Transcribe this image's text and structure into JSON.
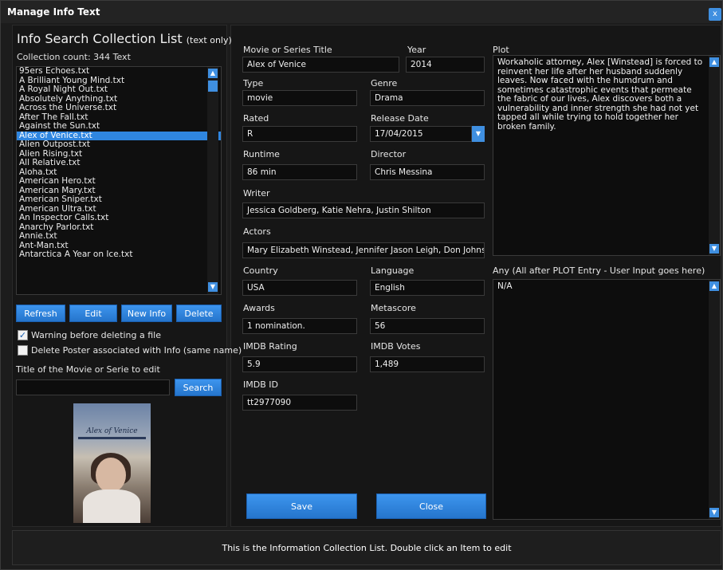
{
  "window": {
    "title": "Manage Info Text",
    "close_glyph": "x"
  },
  "list": {
    "title": "Info Search Collection List",
    "title_suffix": "(text only)",
    "count_text": "Collection count: 344 Text",
    "items": [
      "95ers Echoes.txt",
      "A Brilliant Young Mind.txt",
      "A Royal Night Out.txt",
      "Absolutely Anything.txt",
      "Across the Universe.txt",
      "After The Fall.txt",
      "Against the Sun.txt",
      "Alex of Venice.txt",
      "Alien Outpost.txt",
      "Alien Rising.txt",
      "All Relative.txt",
      "Aloha.txt",
      "American Hero.txt",
      "American Mary.txt",
      "American Sniper.txt",
      "American Ultra.txt",
      "An Inspector Calls.txt",
      "Anarchy Parlor.txt",
      "Annie.txt",
      "Ant-Man.txt",
      "Antarctica A Year on Ice.txt"
    ],
    "selected_index": 7
  },
  "buttons": {
    "refresh": "Refresh",
    "edit": "Edit",
    "new_info": "New Info",
    "delete": "Delete",
    "search": "Search",
    "save": "Save",
    "close": "Close"
  },
  "options": {
    "warning_label": "Warning before deleting a file",
    "warning_checked": true,
    "delete_poster_label": "Delete Poster associated with Info (same name)",
    "delete_poster_checked": false
  },
  "search": {
    "label": "Title of the Movie or Serie to edit",
    "value": ""
  },
  "poster": {
    "caption": "Alex of Venice",
    "icon": "movie-poster-image"
  },
  "form": {
    "title_label": "Movie or Series Title",
    "title_value": "Alex of Venice",
    "year_label": "Year",
    "year_value": "2014",
    "type_label": "Type",
    "type_value": "movie",
    "genre_label": "Genre",
    "genre_value": "Drama",
    "rated_label": "Rated",
    "rated_value": "R",
    "release_label": "Release Date",
    "release_value": "17/04/2015",
    "runtime_label": "Runtime",
    "runtime_value": "86 min",
    "director_label": "Director",
    "director_value": "Chris Messina",
    "writer_label": "Writer",
    "writer_value": "Jessica Goldberg, Katie Nehra, Justin Shilton",
    "actors_label": "Actors",
    "actors_value": "Mary Elizabeth Winstead, Jennifer Jason Leigh, Don Johnso",
    "country_label": "Country",
    "country_value": "USA",
    "language_label": "Language",
    "language_value": "English",
    "awards_label": "Awards",
    "awards_value": "1 nomination.",
    "metascore_label": "Metascore",
    "metascore_value": "56",
    "imdb_rating_label": "IMDB Rating",
    "imdb_rating_value": "5.9",
    "imdb_votes_label": "IMDB Votes",
    "imdb_votes_value": "1,489",
    "imdb_id_label": "IMDB ID",
    "imdb_id_value": "tt2977090",
    "plot_label": "Plot",
    "plot_value": "Workaholic attorney, Alex [Winstead] is forced to reinvent her life after her husband suddenly leaves. Now faced with the humdrum and sometimes catastrophic events that permeate the fabric of our lives, Alex discovers both a vulnerability and inner strength she had not yet tapped all while trying to hold together her broken family.",
    "any_label": "Any (All after PLOT Entry - User Input goes here)",
    "any_value": "N/A"
  },
  "status": {
    "text": "This is the Information Collection List. Double click an Item to edit"
  },
  "colors": {
    "accent": "#2f86e0",
    "background": "#1c1c1c",
    "panel": "#161616"
  }
}
